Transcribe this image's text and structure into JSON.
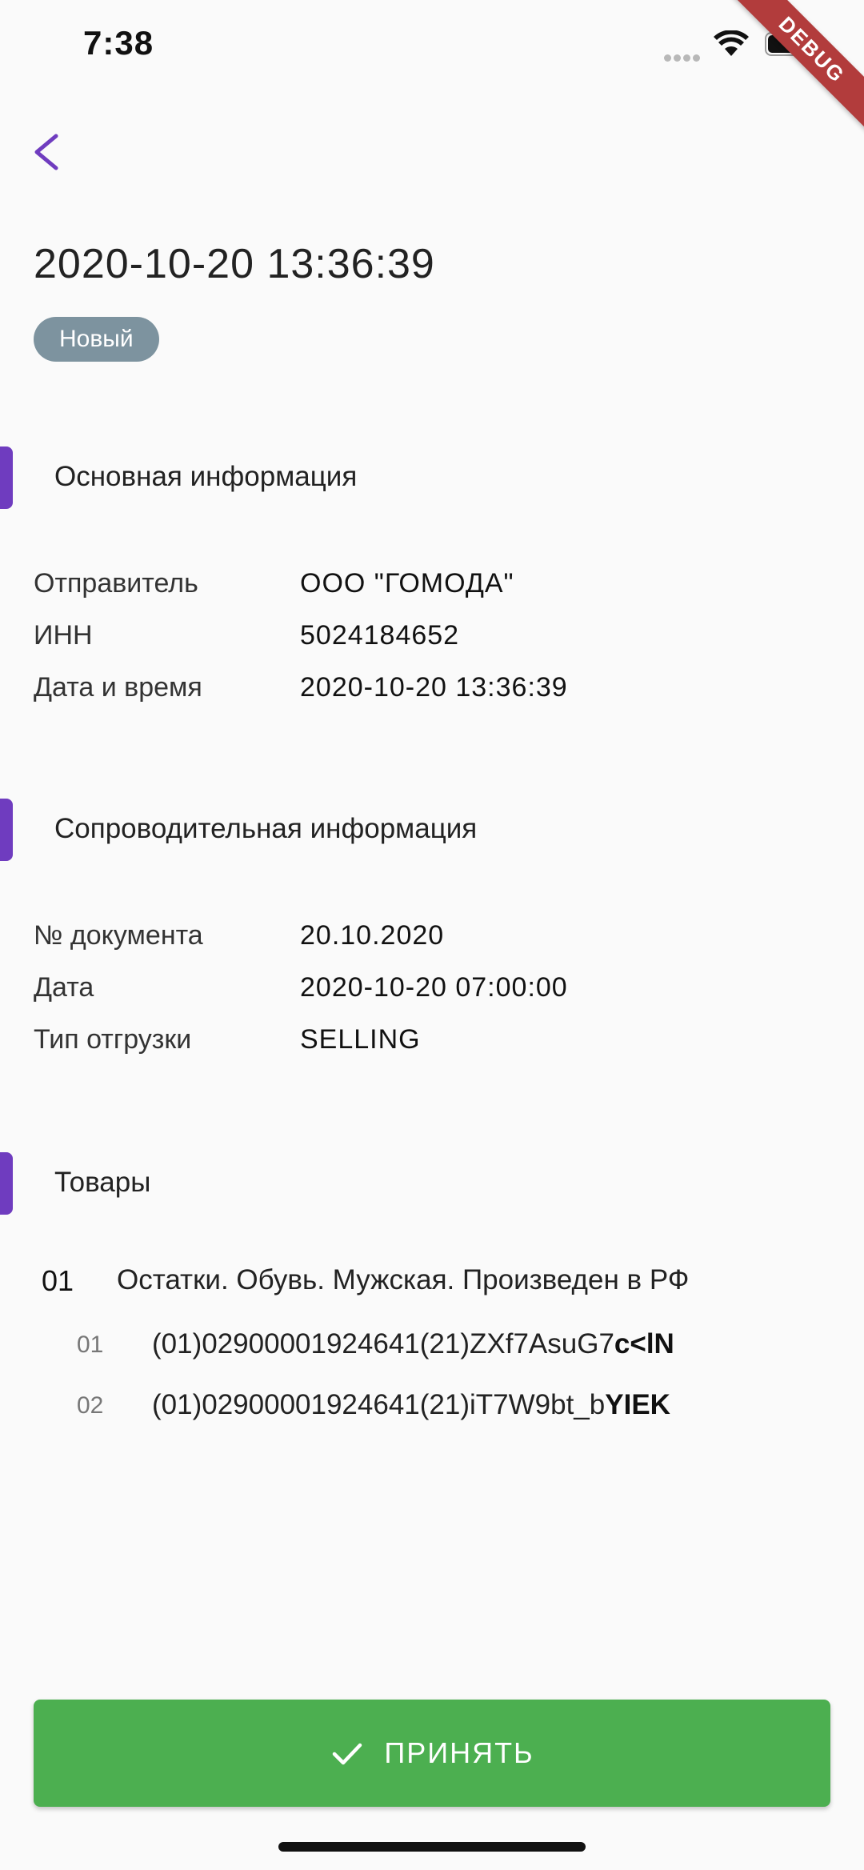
{
  "status_bar": {
    "time": "7:38"
  },
  "debug_banner": "DEBUG",
  "header": {
    "title": "2020-10-20 13:36:39",
    "status_badge": "Новый"
  },
  "sections": {
    "basic": {
      "title": "Основная информация",
      "rows": [
        {
          "label": "Отправитель",
          "value": "ООО \"ГОМОДА\""
        },
        {
          "label": "ИНН",
          "value": "5024184652"
        },
        {
          "label": "Дата и время",
          "value": "2020-10-20 13:36:39"
        }
      ]
    },
    "accompanying": {
      "title": "Сопроводительная информация",
      "rows": [
        {
          "label": "№ документа",
          "value": "20.10.2020"
        },
        {
          "label": "Дата",
          "value": "2020-10-20 07:00:00"
        },
        {
          "label": "Тип отгрузки",
          "value": "SELLING"
        }
      ]
    },
    "products": {
      "title": "Товары",
      "items": [
        {
          "index": "01",
          "name": "Остатки. Обувь. Мужская. Произведен в РФ",
          "codes": [
            {
              "index": "01",
              "code_prefix": "(01)02900001924641(21)ZXf7AsuG7",
              "code_suffix": "c<lN"
            },
            {
              "index": "02",
              "code_prefix": "(01)02900001924641(21)iT7W9bt_b",
              "code_suffix": "YIEK"
            }
          ]
        }
      ]
    }
  },
  "actions": {
    "accept_label": "ПРИНЯТЬ"
  },
  "colors": {
    "accent": "#6f3cbf",
    "badge": "#7d939f",
    "accept": "#4caf50",
    "debug": "#b23c3c"
  }
}
